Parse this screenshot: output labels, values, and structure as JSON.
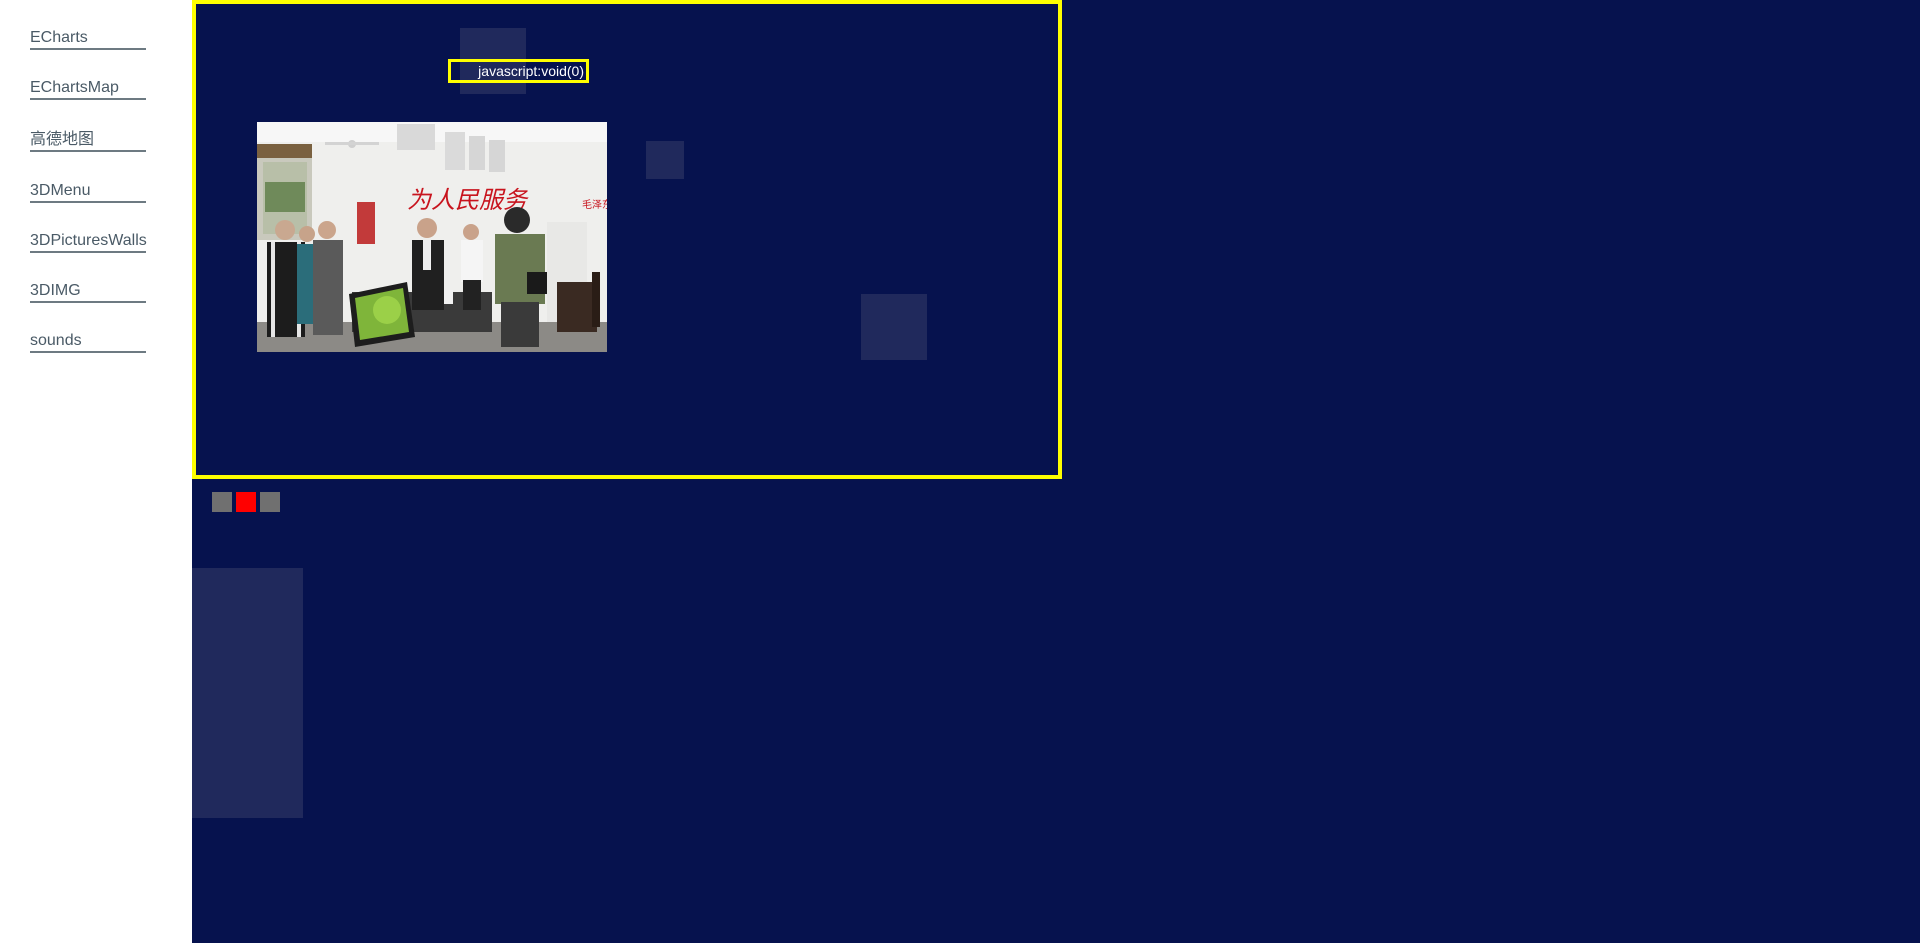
{
  "sidebar": {
    "items": [
      {
        "label": "ECharts"
      },
      {
        "label": "EChartsMap"
      },
      {
        "label": "高德地图"
      },
      {
        "label": "3DMenu"
      },
      {
        "label": "3DPicturesWalls"
      },
      {
        "label": "3DIMG"
      },
      {
        "label": "sounds"
      }
    ]
  },
  "carousel": {
    "link_text": "javascript:void(0)",
    "photo_banner_text": "为人民服务",
    "photo_signature": "毛泽东",
    "active_index": 2,
    "indicator_count": 3
  },
  "colors": {
    "background": "#06124e",
    "frame_border": "#ffff00",
    "indicator_active": "#ff0000",
    "indicator_inactive": "#707070",
    "decorative_square": "#20295c",
    "sidebar_link": "#4a5a66"
  }
}
